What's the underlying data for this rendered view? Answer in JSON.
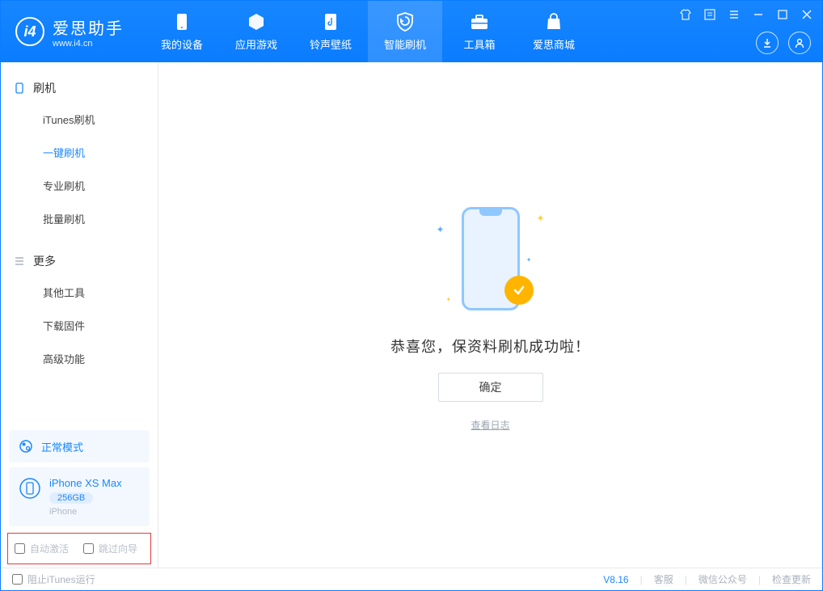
{
  "app": {
    "name": "爱思助手",
    "site": "www.i4.cn"
  },
  "nav": [
    {
      "key": "device",
      "label": "我的设备"
    },
    {
      "key": "apps",
      "label": "应用游戏"
    },
    {
      "key": "ringtone",
      "label": "铃声壁纸"
    },
    {
      "key": "flash",
      "label": "智能刷机"
    },
    {
      "key": "toolbox",
      "label": "工具箱"
    },
    {
      "key": "store",
      "label": "爱思商城"
    }
  ],
  "sidebar": {
    "flash": {
      "title": "刷机",
      "items": [
        {
          "key": "itunes",
          "label": "iTunes刷机"
        },
        {
          "key": "oneclick",
          "label": "一键刷机"
        },
        {
          "key": "pro",
          "label": "专业刷机"
        },
        {
          "key": "batch",
          "label": "批量刷机"
        }
      ]
    },
    "more": {
      "title": "更多",
      "items": [
        {
          "key": "other",
          "label": "其他工具"
        },
        {
          "key": "firmware",
          "label": "下载固件"
        },
        {
          "key": "advanced",
          "label": "高级功能"
        }
      ]
    }
  },
  "mode": {
    "label": "正常模式"
  },
  "device": {
    "name": "iPhone XS Max",
    "capacity": "256GB",
    "type": "iPhone"
  },
  "options": {
    "auto_activate": "自动激活",
    "skip_guide": "跳过向导"
  },
  "main": {
    "success": "恭喜您，保资料刷机成功啦！",
    "ok": "确定",
    "view_log": "查看日志"
  },
  "footer": {
    "block_itunes": "阻止iTunes运行",
    "version": "V8.16",
    "support": "客服",
    "wechat": "微信公众号",
    "update": "检查更新"
  }
}
